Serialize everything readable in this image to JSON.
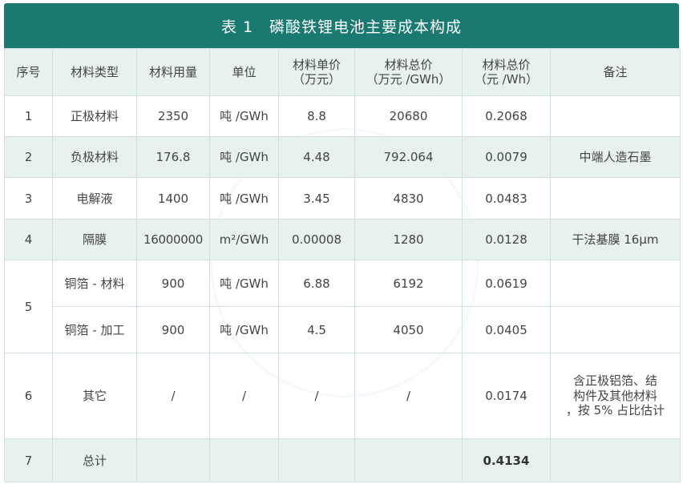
{
  "table": {
    "title": "表 1　磷酸铁锂电池主要成本构成",
    "headers": {
      "index": "序号",
      "type": "材料类型",
      "amount": "材料用量",
      "unit": "单位",
      "unit_price_l1": "材料单价",
      "unit_price_l2": "（万元）",
      "total_l1": "材料总价",
      "total_l2": "（万元 /GWh）",
      "cost_l1": "材料总价",
      "cost_l2": "（元 /Wh）",
      "note": "备注"
    },
    "rows": [
      {
        "index": "1",
        "type": "正极材料",
        "amount": "2350",
        "unit": "吨 /GWh",
        "price": "8.8",
        "total": "20680",
        "cost": "0.2068",
        "note": ""
      },
      {
        "index": "2",
        "type": "负极材料",
        "amount": "176.8",
        "unit": "吨 /GWh",
        "price": "4.48",
        "total": "792.064",
        "cost": "0.0079",
        "note": "中端人造石墨"
      },
      {
        "index": "3",
        "type": "电解液",
        "amount": "1400",
        "unit": "吨 /GWh",
        "price": "3.45",
        "total": "4830",
        "cost": "0.0483",
        "note": ""
      },
      {
        "index": "4",
        "type": "隔膜",
        "amount": "16000000",
        "unit": "m²/GWh",
        "price": "0.00008",
        "total": "1280",
        "cost": "0.0128",
        "note": "干法基膜 16μm"
      },
      {
        "index": "5",
        "type": "铜箔 - 材料",
        "amount": "900",
        "unit": "吨 /GWh",
        "price": "6.88",
        "total": "6192",
        "cost": "0.0619",
        "note": ""
      },
      {
        "index": "",
        "type": "铜箔 - 加工",
        "amount": "900",
        "unit": "吨 /GWh",
        "price": "4.5",
        "total": "4050",
        "cost": "0.0405",
        "note": ""
      },
      {
        "index": "6",
        "type": "其它",
        "amount": "/",
        "unit": "/",
        "price": "/",
        "total": "/",
        "cost": "0.0174",
        "note_l1": "含正极铝箔、结",
        "note_l2": "构件及其他材料",
        "note_l3": "，按 5% 占比估计"
      },
      {
        "index": "7",
        "type": "总计",
        "amount": "",
        "unit": "",
        "price": "",
        "total": "",
        "cost": "0.4134",
        "note": ""
      }
    ]
  },
  "colors": {
    "header_bar": "#1a7a71",
    "row_shade": "#e7f2ef",
    "border": "#cfe0dd"
  }
}
